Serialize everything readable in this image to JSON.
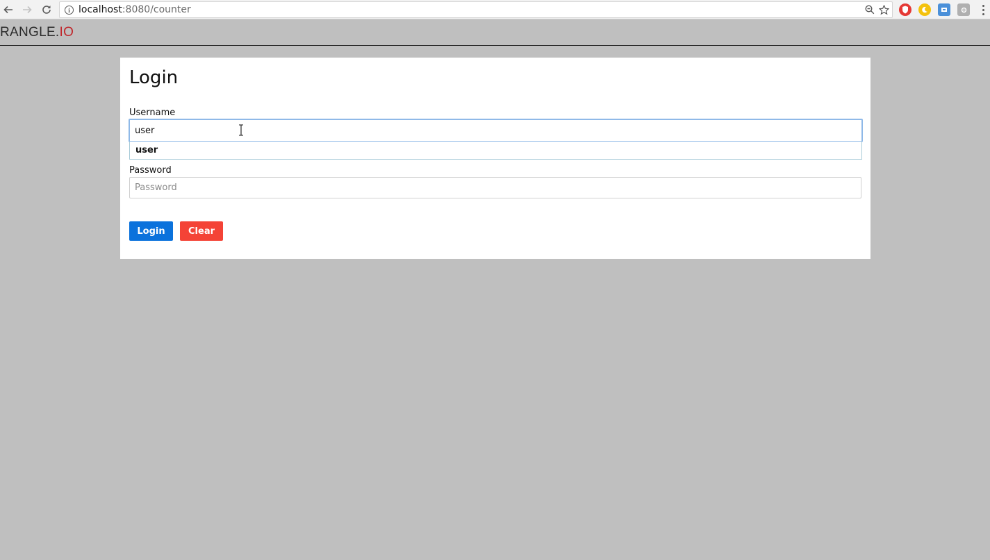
{
  "browser": {
    "url_host": "localhost",
    "url_rest": ":8080/counter",
    "icons": {
      "back": "arrow-left-icon",
      "forward": "arrow-right-icon",
      "reload": "reload-icon",
      "info": "info-icon",
      "zoom": "zoom-icon",
      "bookmark": "star-icon",
      "menu": "more-vert-icon"
    },
    "extensions": [
      {
        "name": "red-shield-extension-icon",
        "color": "#e53935"
      },
      {
        "name": "yellow-moon-extension-icon",
        "color": "#f4c20d"
      },
      {
        "name": "blue-tag-extension-icon",
        "color": "#4a90d9"
      },
      {
        "name": "gray-gear-extension-icon",
        "color": "#b0b0b0"
      }
    ]
  },
  "header": {
    "brand_main": "RANGLE.",
    "brand_accent": "IO"
  },
  "login": {
    "title": "Login",
    "username_label": "Username",
    "username_value": "user",
    "autocomplete_item": "user",
    "password_label": "Password",
    "password_placeholder": "Password",
    "login_button": "Login",
    "clear_button": "Clear"
  },
  "colors": {
    "page_background": "#bfbfbf",
    "login_button": "#0b72dc",
    "clear_button": "#f44336",
    "brand_accent": "#c0262b",
    "focus_ring": "#8fb9e8"
  }
}
